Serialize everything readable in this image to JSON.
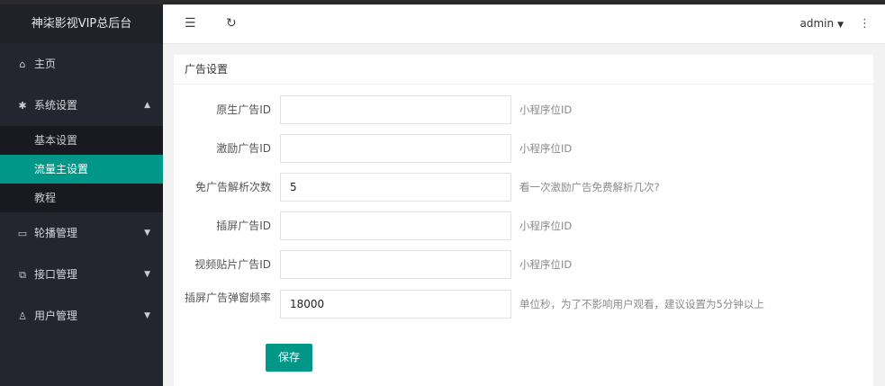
{
  "app": {
    "title": "神柒影视VIP总后台"
  },
  "sidebar": {
    "items": [
      {
        "label": "主页",
        "icon": "home-icon"
      },
      {
        "label": "系统设置",
        "icon": "gear-icon"
      },
      {
        "label": "轮播管理",
        "icon": "image-icon"
      },
      {
        "label": "接口管理",
        "icon": "plugin-icon"
      },
      {
        "label": "用户管理",
        "icon": "user-icon"
      }
    ],
    "submenu": [
      {
        "label": "基本设置"
      },
      {
        "label": "流量主设置"
      },
      {
        "label": "教程"
      }
    ]
  },
  "header": {
    "user": "admin"
  },
  "card": {
    "title": "广告设置",
    "fields": [
      {
        "label": "原生广告ID",
        "value": "",
        "hint": "小程序位ID"
      },
      {
        "label": "激励广告ID",
        "value": "",
        "hint": "小程序位ID"
      },
      {
        "label": "免广告解析次数",
        "value": "5",
        "hint": "看一次激励广告免费解析几次?"
      },
      {
        "label": "插屏广告ID",
        "value": "",
        "hint": "小程序位ID"
      },
      {
        "label": "视频贴片广告ID",
        "value": "",
        "hint": "小程序位ID"
      },
      {
        "label": "插屏广告弹窗频率",
        "value": "18000",
        "hint": "单位秒，为了不影响用户观看，建议设置为5分钟以上"
      }
    ],
    "save_label": "保存"
  }
}
